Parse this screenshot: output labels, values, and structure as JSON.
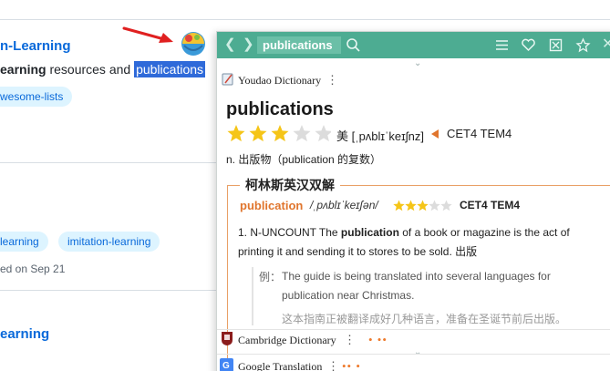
{
  "background": {
    "repo1_title": "n-Learning",
    "repo1_desc_bold": "earning",
    "repo1_desc_mid": " resources and ",
    "repo1_desc_selected": "publications",
    "repo1_topic": "wesome-lists",
    "repo2_topic_a": "learning",
    "repo2_topic_b": "imitation-learning",
    "repo2_updated": "ed on Sep 21",
    "repo3_title": "earning"
  },
  "popup": {
    "search_value": "publications",
    "icons": [
      "back-icon",
      "forward-icon",
      "search-icon",
      "menu-icon",
      "heart-icon",
      "wordbook-icon",
      "pin-icon",
      "close-icon"
    ],
    "youdao": {
      "source_label": "Youdao Dictionary",
      "word": "publications",
      "star_rating": 3,
      "star_max": 5,
      "phonetic_region": "美",
      "phonetic": "[ˌpʌblɪˈkeɪʃnz]",
      "exams": "CET4 TEM4",
      "translation": "n. 出版物（publication 的复数）"
    },
    "collins": {
      "title": "柯林斯英汉双解",
      "word": "publication",
      "phonetic": "/ˌpʌblɪˈkeɪʃən/",
      "star_rating": 3,
      "star_max": 5,
      "exams": "CET4 TEM4",
      "def_num": "1.",
      "def_pre": " N-UNCOUNT The ",
      "def_word": "publication",
      "def_post": " of a book or magazine is the act of printing it and sending it to stores to be sold. 出版",
      "example_label": "例：",
      "example_en": "The guide is being translated into several languages for publication near Christmas.",
      "example_zh": "这本指南正被翻译成好几种语言，准备在圣诞节前后出版。"
    },
    "cambridge_label": "Cambridge Dictionary",
    "google_label": "Google Translation",
    "colors": {
      "bar": "#4dac92",
      "accent": "#e0752d",
      "star": "#f5c518",
      "selection": "#2f6ad9",
      "link": "#0969da"
    }
  }
}
